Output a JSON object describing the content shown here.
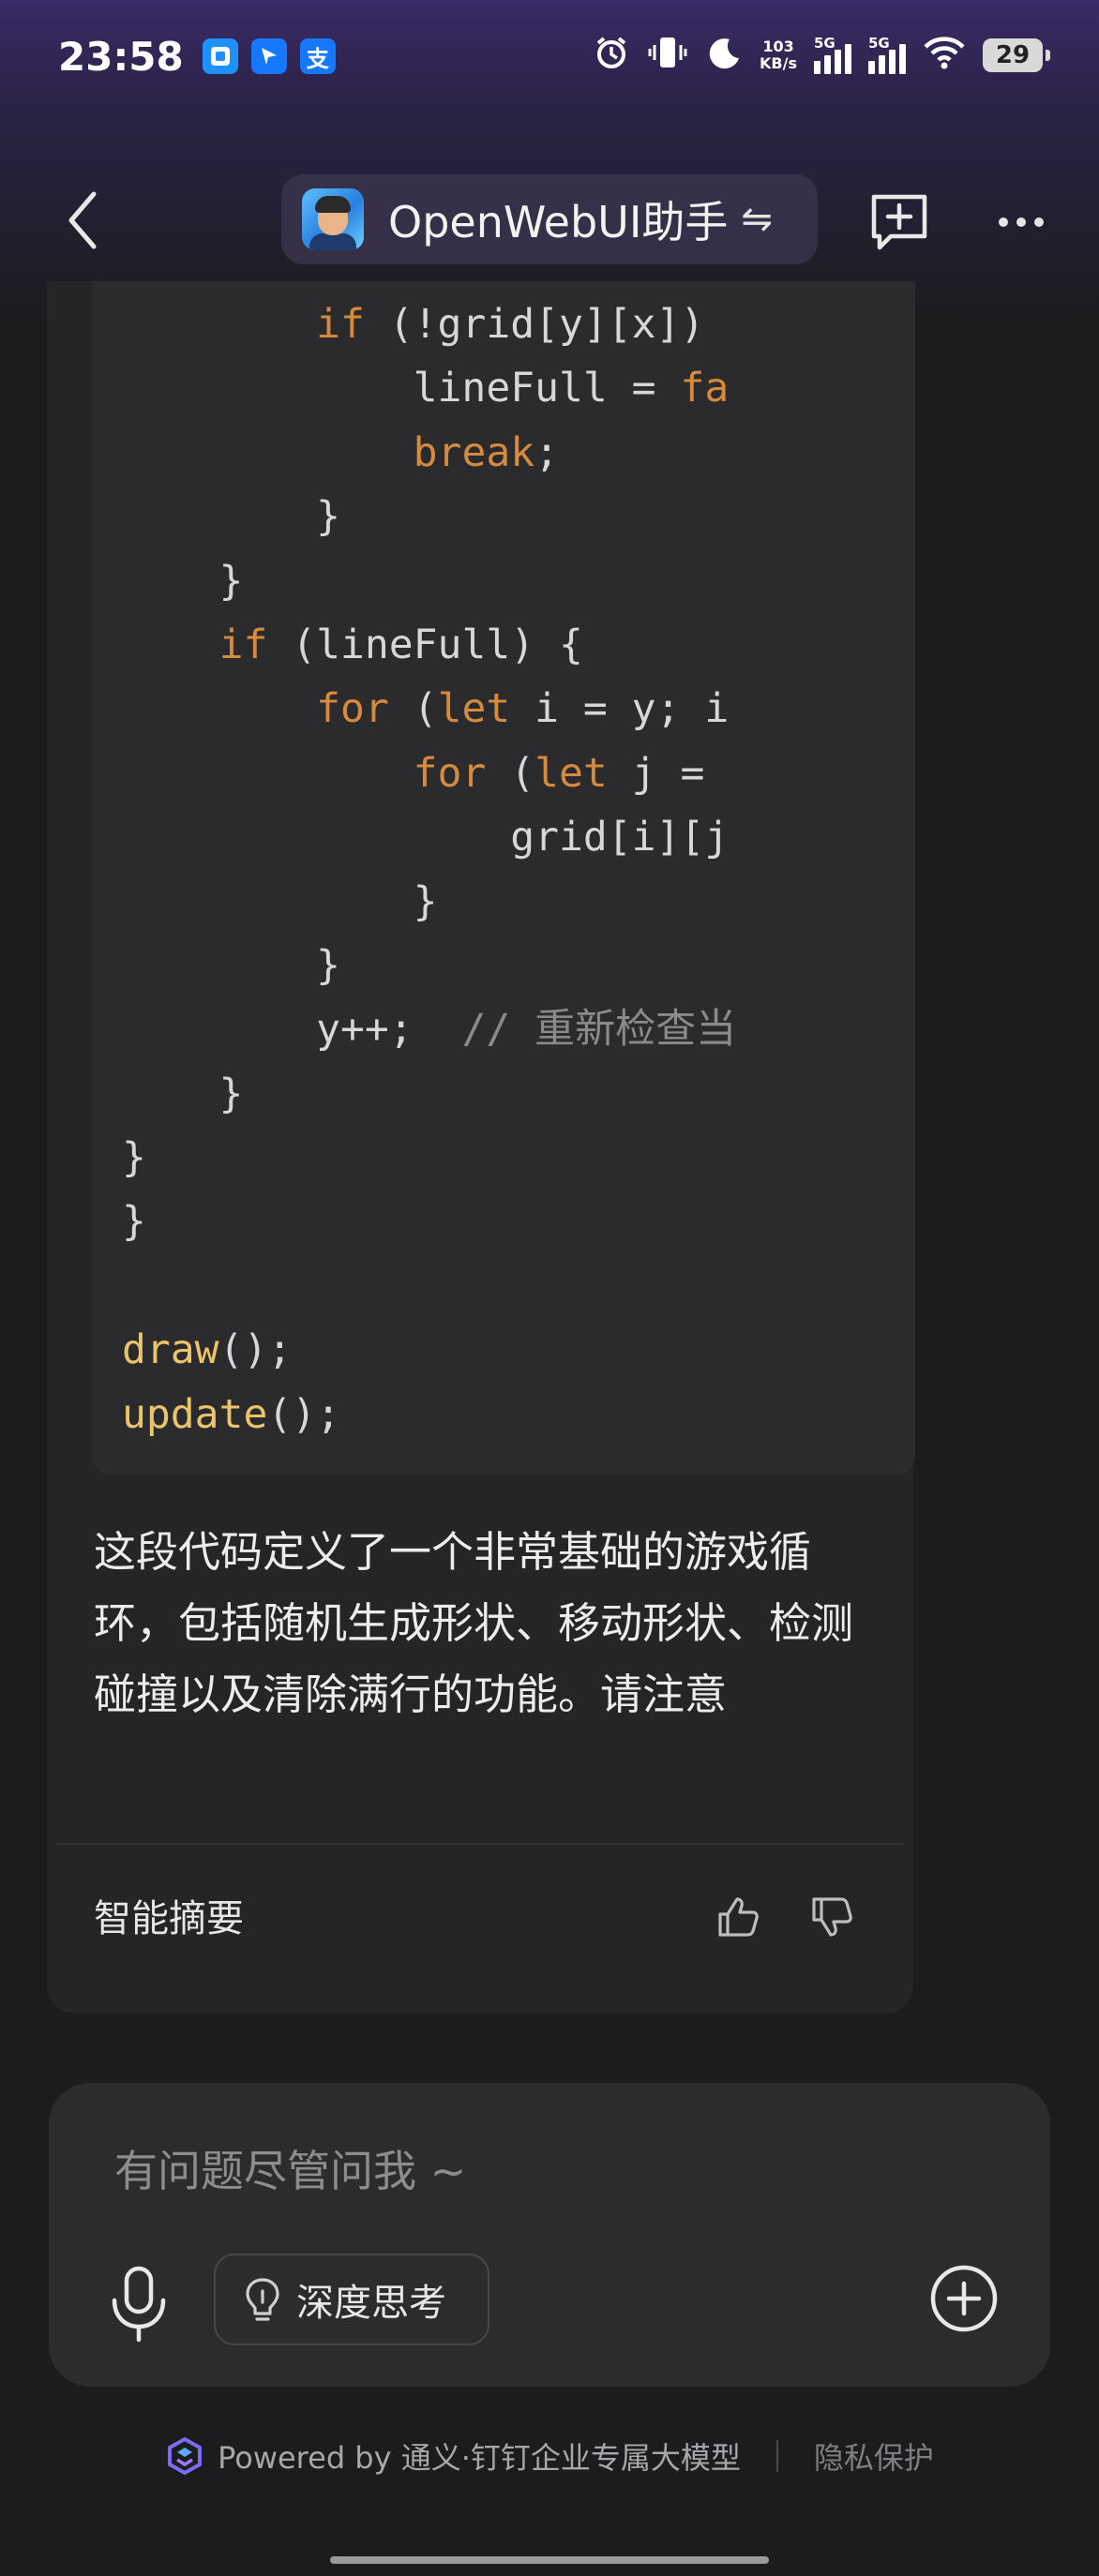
{
  "status_bar": {
    "time": "23:58",
    "net_speed_value": "103",
    "net_speed_unit": "KB/s",
    "signal1_label": "5G",
    "signal2_label": "5G",
    "battery": "29",
    "app_icons": [
      "dingtalk-icon",
      "lark-icon",
      "alipay-icon"
    ],
    "alipay_glyph": "支"
  },
  "header": {
    "title": "OpenWebUI助手",
    "swap_glyph": "⇋"
  },
  "code_lines": [
    "        if (!grid[y][x])",
    "            lineFull = fa",
    "            break;",
    "        }",
    "    }",
    "    if (lineFull) {",
    "        for (let i = y; i",
    "            for (let j =",
    "                grid[i][j",
    "            }",
    "        }",
    "        y++;  // 重新检查当",
    "    }",
    "}",
    "}",
    "",
    "draw();",
    "update();"
  ],
  "answer": {
    "text": "这段代码定义了一个非常基础的游戏循环，包括随机生成形状、移动形状、检测碰撞以及清除满行的功能。请注意"
  },
  "card_footer": {
    "summary_label": "智能摘要"
  },
  "input": {
    "placeholder": "有问题尽管问我 ~",
    "deep_think_label": "深度思考"
  },
  "footer": {
    "powered_text": "Powered by 通义·钉钉企业专属大模型",
    "privacy_label": "隐私保护"
  },
  "colors": {
    "background": "#1c1c1e",
    "card": "#252527",
    "code_bg": "#2b2b2d",
    "keyword": "#d58a3d",
    "function": "#e9c46a",
    "comment": "#8a8a8a"
  }
}
